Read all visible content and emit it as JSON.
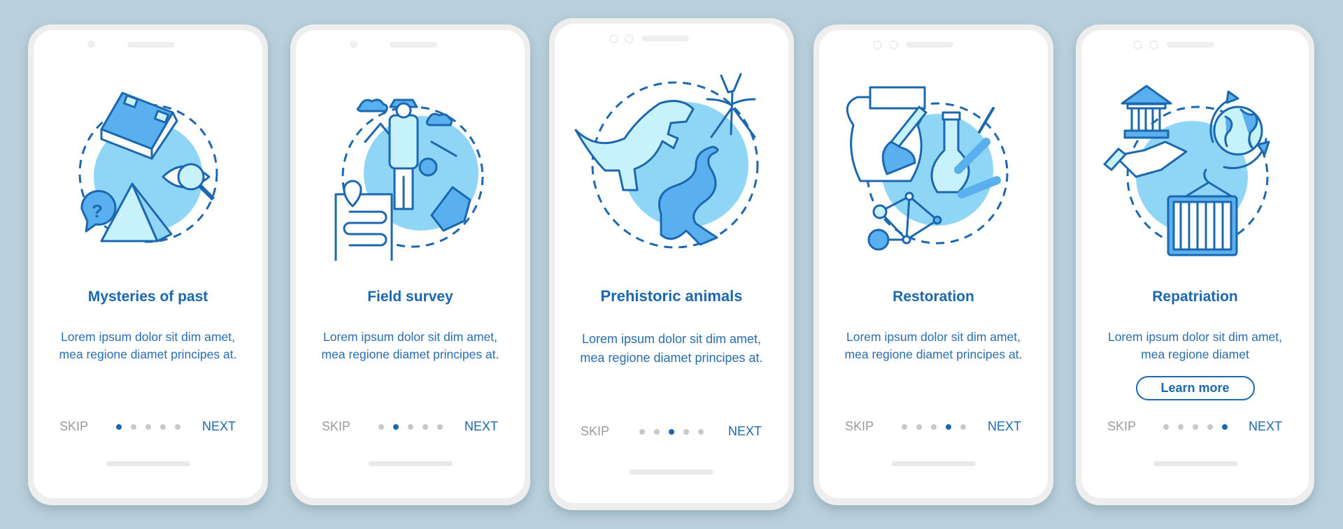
{
  "colors": {
    "background": "#b9cfdb",
    "accent": "#1c68b0",
    "light_blue": "#8fd6f6",
    "pale_blue": "#c8f2fb",
    "mid_blue": "#5ab0ee",
    "muted": "#9b9b9b",
    "dot_inactive": "#c8c8c8"
  },
  "screens": [
    {
      "title": "Mysteries of past",
      "body": "Lorem ipsum dolor sit dim amet, mea regione diamet principes at.",
      "illustration": "book-eye-pyramid-question-icon",
      "skip_label": "SKIP",
      "next_label": "NEXT",
      "page_index": 1,
      "page_count": 5
    },
    {
      "title": "Field survey",
      "body": "Lorem ipsum dolor sit dim amet, mea regione diamet principes at.",
      "illustration": "explorer-map-fossil-icon",
      "skip_label": "SKIP",
      "next_label": "NEXT",
      "page_index": 2,
      "page_count": 5
    },
    {
      "title": "Prehistoric animals",
      "body": "Lorem ipsum dolor sit dim amet, mea regione diamet principes at.",
      "illustration": "dinosaur-mosquito-dragon-icon",
      "skip_label": "SKIP",
      "next_label": "NEXT",
      "page_index": 3,
      "page_count": 5
    },
    {
      "title": "Restoration",
      "body": "Lorem ipsum dolor sit dim amet, mea regione diamet principes at.",
      "illustration": "vase-brush-flask-bones-icon",
      "skip_label": "SKIP",
      "next_label": "NEXT",
      "page_index": 4,
      "page_count": 5
    },
    {
      "title": "Repatriation",
      "body": "Lorem ipsum dolor sit dim amet, mea regione diamet",
      "illustration": "museum-handshake-globe-container-icon",
      "button_label": "Learn more",
      "skip_label": "SKIP",
      "next_label": "NEXT",
      "page_index": 5,
      "page_count": 5
    }
  ]
}
